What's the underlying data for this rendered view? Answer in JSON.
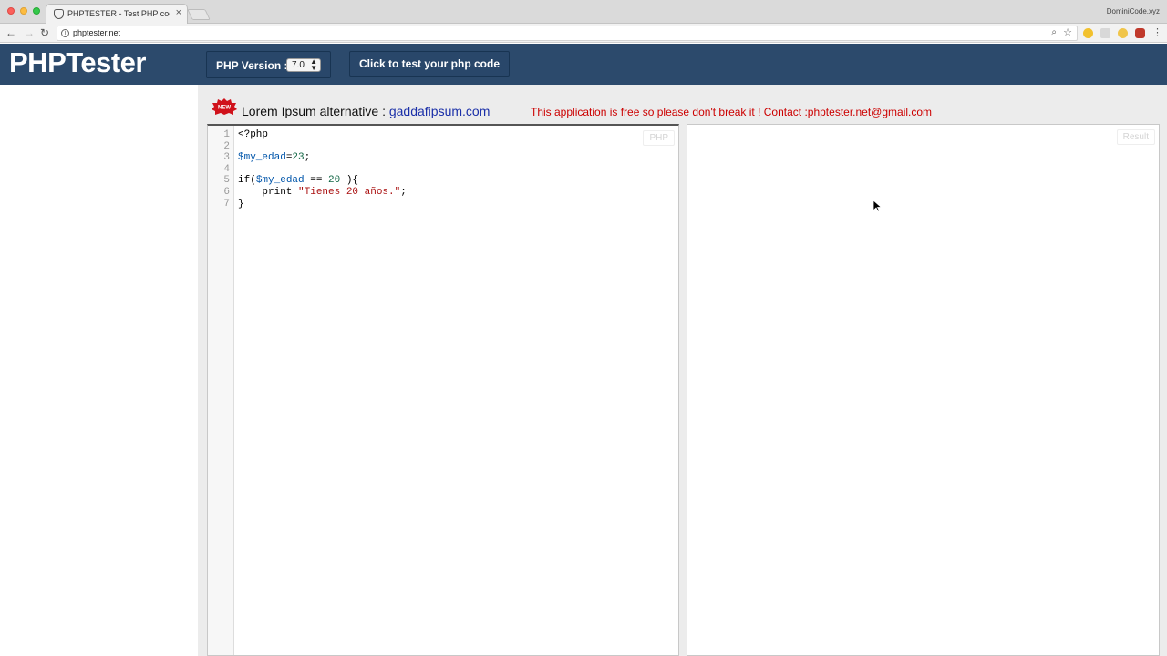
{
  "browser": {
    "tab_title": "PHPTESTER - Test PHP code",
    "tab_close": "×",
    "profile_name": "DominiCode.xyz",
    "url": "phptester.net",
    "icons": {
      "back": "arrow-left-icon",
      "forward": "arrow-right-icon",
      "reload": "reload-icon",
      "info": "info-icon",
      "zoom": "zoom-icon",
      "bookmark": "star-icon",
      "menu": "menu-dots-icon"
    }
  },
  "header": {
    "brand": "PHPTester",
    "version_label": "PHP Version :",
    "version_value": "7.0",
    "test_button": "Click to test your php code",
    "bg_color": "#2c4a6c"
  },
  "notice": {
    "badge": "NEW",
    "prefix": "Lorem Ipsum alternative :",
    "link_text": "gaddafipsum.com",
    "free_note": "This application is free so please don't break it ! Contact :phptester.net@gmail.com"
  },
  "editor": {
    "tag": "PHP",
    "line_numbers": [
      "1",
      "2",
      "3",
      "4",
      "5",
      "6",
      "7"
    ],
    "lines": [
      [
        {
          "t": "<?php",
          "c": ""
        }
      ],
      [],
      [
        {
          "t": "$my_edad",
          "c": "var"
        },
        {
          "t": "=",
          "c": ""
        },
        {
          "t": "23",
          "c": "num"
        },
        {
          "t": ";",
          "c": ""
        }
      ],
      [],
      [
        {
          "t": "if(",
          "c": ""
        },
        {
          "t": "$my_edad",
          "c": "var"
        },
        {
          "t": " == ",
          "c": ""
        },
        {
          "t": "20",
          "c": "num"
        },
        {
          "t": " ){",
          "c": ""
        }
      ],
      [
        {
          "t": "    print ",
          "c": ""
        },
        {
          "t": "\"Tienes 20 años.\"",
          "c": "str"
        },
        {
          "t": ";",
          "c": ""
        }
      ],
      [
        {
          "t": "}",
          "c": ""
        }
      ]
    ]
  },
  "result": {
    "tag": "Result"
  }
}
